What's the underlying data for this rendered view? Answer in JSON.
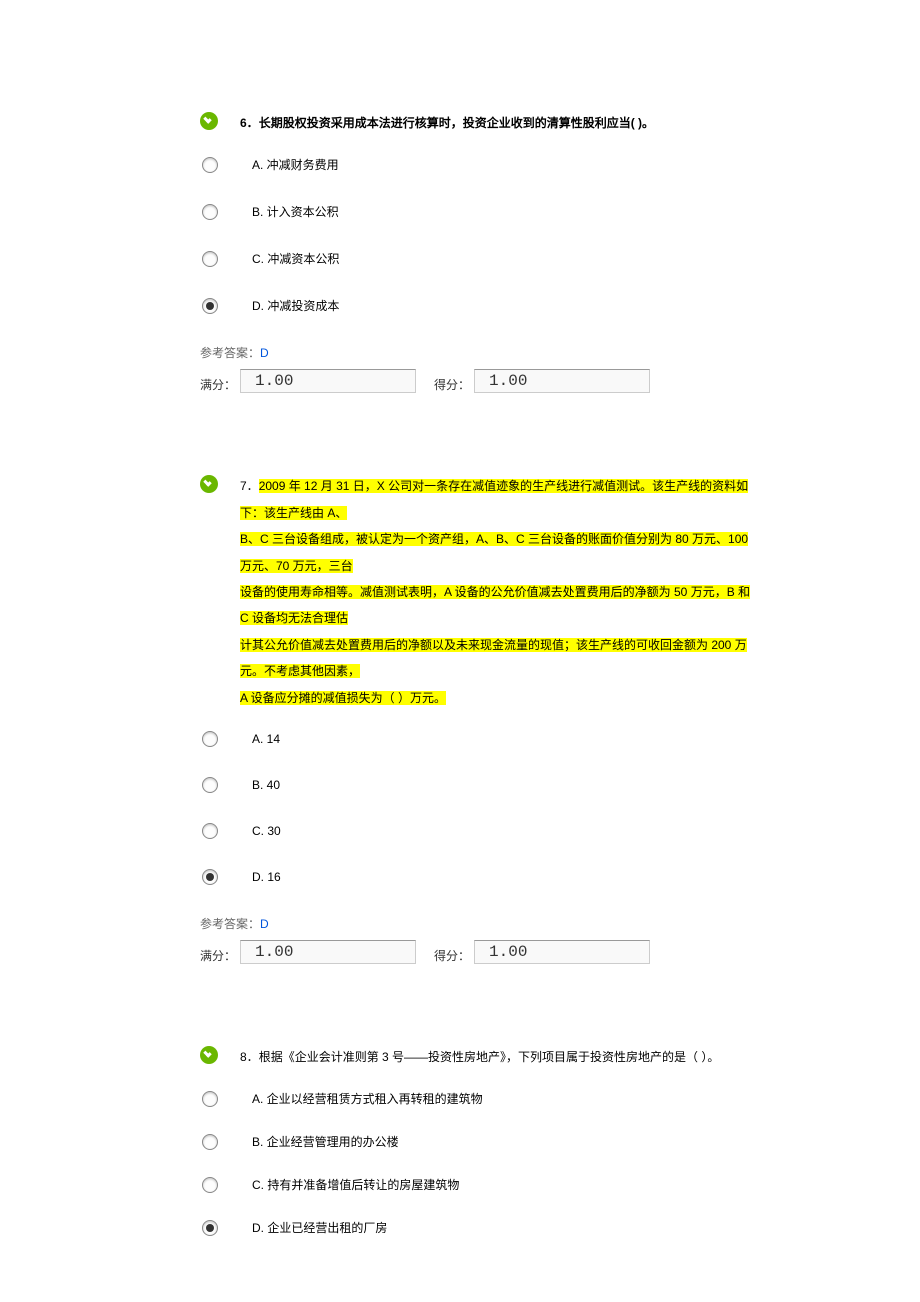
{
  "questions": [
    {
      "number": "6．",
      "stem": "长期股权投资采用成本法进行核算时，投资企业收到的清算性股利应当(    )。",
      "options": [
        {
          "label": "A. 冲减财务费用",
          "selected": false
        },
        {
          "label": "B. 计入资本公积",
          "selected": false
        },
        {
          "label": "C. 冲减资本公积",
          "selected": false
        },
        {
          "label": "D. 冲减投资成本",
          "selected": true
        }
      ],
      "answer_prefix": "参考答案：",
      "answer_value": "D",
      "full_label": "满分：",
      "full_value": "1.00",
      "got_label": "得分：",
      "got_value": "1.00"
    },
    {
      "number": "7．",
      "stem_parts": {
        "a": "2009 年 12 月 31 日，X 公司对一条存在减值迹象的生产线进行减值测试。该生产线的资料如下：该生产线由 A、",
        "b": "B、C 三台设备组成，被认定为一个资产组，A、B、C 三台设备的账面价值分别为 80 万元、100 万元、70 万元，三台",
        "c": "设备的使用寿命相等。减值测试表明，A 设备的公允价值减去处置费用后的净额为 50 万元，B 和 C 设备均无法合理估",
        "d": "计其公允价值减去处置费用后的净额以及未来现金流量的现值；该生产线的可收回金额为 200 万元。不考虑其他因素，",
        "e": "A 设备应分摊的减值损失为（     ）万元。"
      },
      "options": [
        {
          "label": "A. 14",
          "selected": false
        },
        {
          "label": "B. 40",
          "selected": false
        },
        {
          "label": "C. 30",
          "selected": false
        },
        {
          "label": "D. 16",
          "selected": true
        }
      ],
      "answer_prefix": "参考答案：",
      "answer_value": "D",
      "full_label": "满分：",
      "full_value": "1.00",
      "got_label": "得分：",
      "got_value": "1.00"
    },
    {
      "number": "8．",
      "stem": "根据《企业会计准则第 3 号——投资性房地产》，下列项目属于投资性房地产的是（    ）。",
      "options": [
        {
          "label": "A. 企业以经营租赁方式租入再转租的建筑物",
          "selected": false
        },
        {
          "label": "B. 企业经营管理用的办公楼",
          "selected": false
        },
        {
          "label": "C. 持有并准备增值后转让的房屋建筑物",
          "selected": false
        },
        {
          "label": "D. 企业已经营出租的厂房",
          "selected": true
        }
      ]
    }
  ]
}
